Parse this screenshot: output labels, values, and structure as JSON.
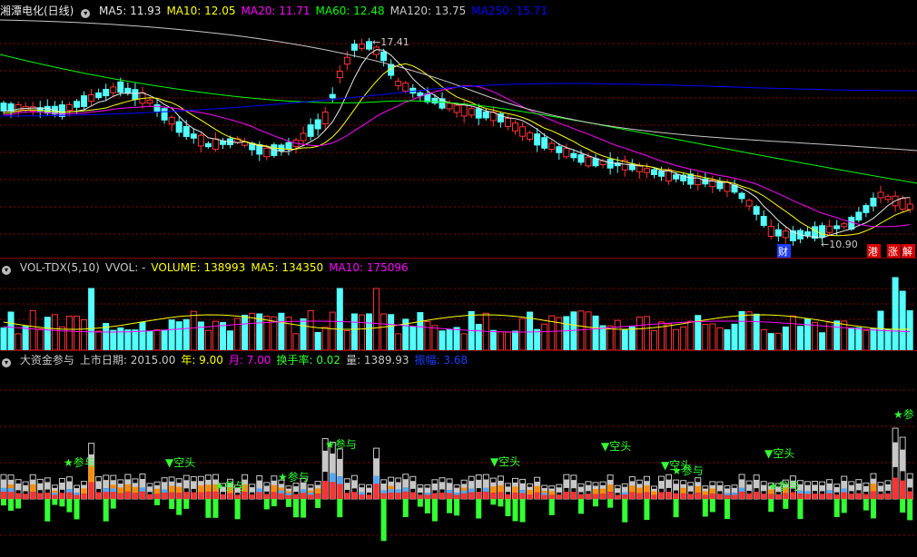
{
  "colors": {
    "up": "#ff3232",
    "down": "#54ffff",
    "ma5": "#e8e8e8",
    "ma10": "#ffff00",
    "ma20": "#ff00ff",
    "ma60": "#00ff00",
    "ma120": "#c8c8c8",
    "ma250": "#0000ff",
    "grid": "#8b0000",
    "gray_bar": "#c8c8c8",
    "orange_bar": "#ff8c00",
    "blue_bar": "#4ea8ff",
    "green_bar": "#33ff33",
    "label_green": "#33ff33"
  },
  "price_panel": {
    "title": "湘潭电化(日线)",
    "ma_labels": [
      {
        "text": "MA5: 11.93",
        "color": "#e8e8e8"
      },
      {
        "text": "MA10: 12.05",
        "color": "#ffff00"
      },
      {
        "text": "MA20: 11.71",
        "color": "#ff00ff"
      },
      {
        "text": "MA60: 12.48",
        "color": "#00ff00"
      },
      {
        "text": "MA120: 13.75",
        "color": "#c8c8c8"
      },
      {
        "text": "MA250: 15.71",
        "color": "#0000ff"
      }
    ],
    "high_label": "17.41",
    "low_label": "10.90",
    "event_badges": [
      {
        "text": "财",
        "color": "#1a3cff"
      },
      {
        "text": "港",
        "color": "#d60000"
      },
      {
        "text": "涨",
        "color": "#d60000"
      },
      {
        "text": "解",
        "color": "#d60000"
      }
    ]
  },
  "volume_panel": {
    "labels": [
      {
        "text": "VOL-TDX(5,10)",
        "color": "#c8c8c8"
      },
      {
        "text": "VVOL: -",
        "color": "#c8c8c8"
      },
      {
        "text": "VOLUME: 138993",
        "color": "#ffff00"
      },
      {
        "text": "MA5: 134350",
        "color": "#ffff00"
      },
      {
        "text": "MA10: 175096",
        "color": "#ff00ff"
      }
    ]
  },
  "fund_panel": {
    "labels": [
      {
        "text": "大资金参与",
        "color": "#c8c8c8"
      },
      {
        "text": "上市日期: 2015.00",
        "color": "#c8c8c8"
      },
      {
        "text": "年: 9.00",
        "color": "#ffff00"
      },
      {
        "text": "月: 7.00",
        "color": "#ff00ff"
      },
      {
        "text": "换手率: 0.02",
        "color": "#33ff33"
      },
      {
        "text": "量: 1389.93",
        "color": "#c8c8c8"
      },
      {
        "text": "振幅: 3.68",
        "color": "#1a3cff"
      }
    ],
    "signal_short": "▼空头",
    "signal_join": "★参与",
    "signal_join_clipped": "★参"
  }
}
